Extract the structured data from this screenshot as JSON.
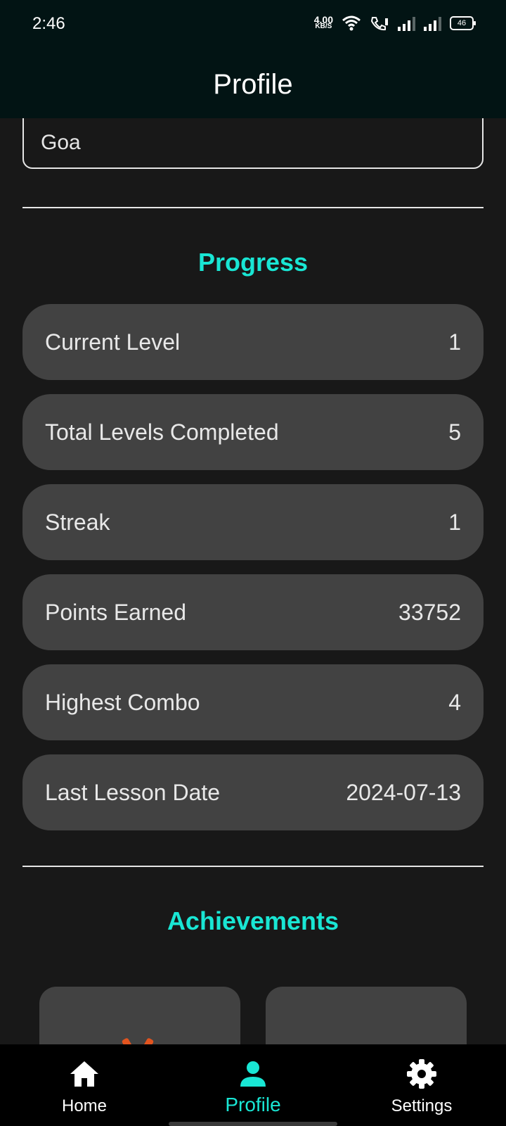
{
  "status_bar": {
    "time": "2:46",
    "net_speed_value": "4.00",
    "net_speed_unit": "KB/S",
    "battery": "46"
  },
  "app_bar": {
    "title": "Profile"
  },
  "location_field": {
    "value": "Goa"
  },
  "progress": {
    "title": "Progress",
    "rows": [
      {
        "label": "Current Level",
        "value": "1"
      },
      {
        "label": "Total Levels Completed",
        "value": "5"
      },
      {
        "label": "Streak",
        "value": "1"
      },
      {
        "label": "Points Earned",
        "value": "33752"
      },
      {
        "label": "Highest Combo",
        "value": "4"
      },
      {
        "label": "Last Lesson Date",
        "value": "2024-07-13"
      }
    ]
  },
  "achievements": {
    "title": "Achievements"
  },
  "bottom_nav": {
    "items": [
      {
        "label": "Home",
        "icon": "home-icon"
      },
      {
        "label": "Profile",
        "icon": "person-icon",
        "active": true
      },
      {
        "label": "Settings",
        "icon": "gear-icon"
      }
    ]
  },
  "colors": {
    "accent": "#19e6d4",
    "background": "#181818",
    "card": "#424242",
    "app_bar": "#021414"
  }
}
